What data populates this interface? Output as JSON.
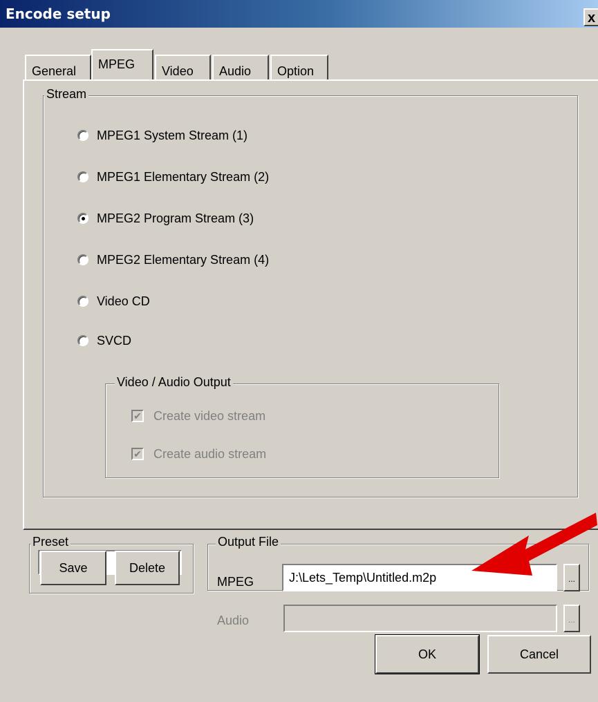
{
  "window": {
    "title": "Encode setup",
    "close_label": "x"
  },
  "tabs": [
    {
      "label": "General"
    },
    {
      "label": "MPEG",
      "active": true
    },
    {
      "label": "Video"
    },
    {
      "label": "Audio"
    },
    {
      "label": "Option"
    }
  ],
  "stream": {
    "legend": "Stream",
    "options": [
      {
        "label": "MPEG1 System Stream (1)",
        "checked": false
      },
      {
        "label": "MPEG1 Elementary Stream (2)",
        "checked": false
      },
      {
        "label": "MPEG2 Program Stream (3)",
        "checked": true
      },
      {
        "label": "MPEG2 Elementary Stream (4)",
        "checked": false
      },
      {
        "label": "Video CD",
        "checked": false
      },
      {
        "label": "SVCD",
        "checked": false
      }
    ],
    "output_group": {
      "legend": "Video / Audio Output",
      "create_video": {
        "label": "Create video stream",
        "checked": true,
        "disabled": true
      },
      "create_audio": {
        "label": "Create audio stream",
        "checked": true,
        "disabled": true
      }
    }
  },
  "preset": {
    "legend": "Preset",
    "selected": "",
    "save_label": "Save",
    "delete_label": "Delete"
  },
  "output_file": {
    "legend": "Output File",
    "mpeg_label": "MPEG",
    "mpeg_value": "J:\\Lets_Temp\\Untitled.m2p",
    "audio_label": "Audio",
    "audio_value": "",
    "browse_label": "..."
  },
  "footer": {
    "ok_label": "OK",
    "cancel_label": "Cancel"
  },
  "annotation": {
    "arrow_color": "#e00000"
  },
  "colors": {
    "face": "#d4d0c8",
    "title_start": "#0a246a",
    "title_end": "#a6caf0"
  }
}
